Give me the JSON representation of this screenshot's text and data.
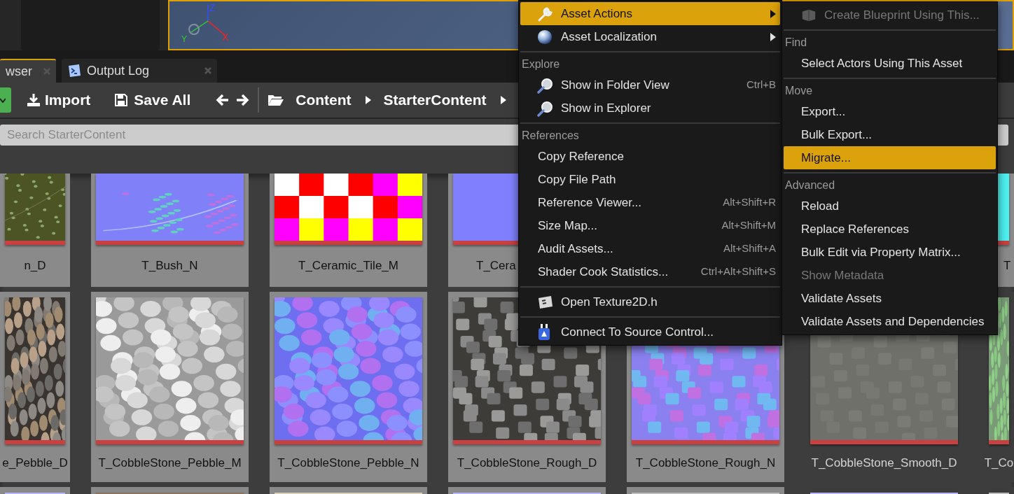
{
  "viewport": {
    "axis_labels": [
      "Z",
      "Y",
      "X"
    ]
  },
  "tabs": [
    {
      "label": "wser",
      "selected": true
    },
    {
      "label": "Output Log",
      "selected": false
    }
  ],
  "toolbar": {
    "buttons": [
      "Import",
      "Save All"
    ],
    "breadcrumbs": [
      "Content",
      "StarterContent"
    ]
  },
  "search": {
    "placeholder": "Search StarterContent"
  },
  "grid": {
    "rows": [
      {
        "tiles": [
          {
            "label": "n_D",
            "kind": "leaves",
            "selected": true,
            "clipped": false
          },
          {
            "label": "T_Bush_N",
            "kind": "normal-leaves",
            "selected": true,
            "clipped": false
          },
          {
            "label": "T_Ceramic_Tile_M",
            "kind": "checker",
            "selected": true,
            "clipped": false
          },
          {
            "label": "T_Cera",
            "kind": "flat-normal",
            "selected": true,
            "clipped": true
          },
          {
            "label": "T",
            "kind": "noise",
            "selected": true,
            "clipped": true
          }
        ]
      },
      {
        "tiles": [
          {
            "label": "e_Pebble_D",
            "kind": "pebble",
            "selected": true,
            "clipped": false
          },
          {
            "label": "T_CobbleStone_Pebble_M",
            "kind": "mask",
            "selected": true,
            "clipped": false
          },
          {
            "label": "T_CobbleStone_Pebble_N",
            "kind": "normal-pebble",
            "selected": true,
            "clipped": false
          },
          {
            "label": "T_CobbleStone_Rough_D",
            "kind": "cobble",
            "selected": true,
            "clipped": false
          },
          {
            "label": "T_CobbleStone_Rough_N",
            "kind": "normal-cobble",
            "selected": true,
            "clipped": false
          },
          {
            "label": "T_CobbleStone_Smooth_D",
            "kind": "smooth",
            "selected": false,
            "clipped": false
          },
          {
            "label": "T_Co",
            "kind": "moss",
            "selected": false,
            "clipped": false
          }
        ]
      },
      {
        "tiles": [
          {
            "kind": "lavender",
            "selected": true
          },
          {
            "kind": "sand",
            "selected": true
          },
          {
            "kind": "plaster",
            "selected": true
          },
          {
            "kind": "lavender",
            "selected": true
          },
          {
            "kind": "concrete",
            "selected": true
          },
          {
            "kind": "lavender",
            "selected": false
          },
          {
            "kind": "concrete",
            "selected": false
          }
        ]
      }
    ]
  },
  "context_menu": {
    "items": [
      {
        "kind": "item",
        "label": "Asset Actions",
        "selected": true,
        "submenu": true
      },
      {
        "kind": "item",
        "label": "Asset Localization",
        "selected": false,
        "submenu": true
      },
      {
        "kind": "separator"
      },
      {
        "kind": "header",
        "label": "Explore"
      },
      {
        "kind": "item",
        "label": "Show in Folder View",
        "shortcut": "Ctrl+B",
        "selected": false,
        "submenu": false
      },
      {
        "kind": "item",
        "label": "Show in Explorer",
        "selected": false,
        "submenu": false
      },
      {
        "kind": "separator"
      },
      {
        "kind": "header",
        "label": "References"
      },
      {
        "kind": "item",
        "label": "Copy Reference",
        "selected": false,
        "submenu": false
      },
      {
        "kind": "item",
        "label": "Copy File Path",
        "selected": false,
        "submenu": false
      },
      {
        "kind": "item",
        "label": "Reference Viewer...",
        "shortcut": "Alt+Shift+R",
        "selected": false,
        "submenu": false
      },
      {
        "kind": "item",
        "label": "Size Map...",
        "shortcut": "Alt+Shift+M",
        "selected": false,
        "submenu": false
      },
      {
        "kind": "item",
        "label": "Audit Assets...",
        "shortcut": "Alt+Shift+A",
        "selected": false,
        "submenu": false
      },
      {
        "kind": "item",
        "label": "Shader Cook Statistics...",
        "shortcut": "Ctrl+Alt+Shift+S",
        "selected": false,
        "submenu": false
      },
      {
        "kind": "separator"
      },
      {
        "kind": "item",
        "label": "Open Texture2D.h",
        "selected": false,
        "submenu": false
      },
      {
        "kind": "separator"
      },
      {
        "kind": "item",
        "label": "Connect To Source Control...",
        "selected": false,
        "submenu": false
      }
    ]
  },
  "submenu": {
    "items": [
      {
        "kind": "item",
        "label": "Create Blueprint Using This...",
        "selected": false,
        "disabled": true
      },
      {
        "kind": "separator"
      },
      {
        "kind": "header",
        "label": "Find"
      },
      {
        "kind": "item",
        "label": "Select Actors Using This Asset",
        "selected": false,
        "disabled": false
      },
      {
        "kind": "separator"
      },
      {
        "kind": "header",
        "label": "Move"
      },
      {
        "kind": "item",
        "label": "Export...",
        "selected": false,
        "disabled": false
      },
      {
        "kind": "item",
        "label": "Bulk Export...",
        "selected": false,
        "disabled": false
      },
      {
        "kind": "item",
        "label": "Migrate...",
        "selected": true,
        "disabled": false
      },
      {
        "kind": "separator"
      },
      {
        "kind": "header",
        "label": "Advanced"
      },
      {
        "kind": "item",
        "label": "Reload",
        "selected": false,
        "disabled": false
      },
      {
        "kind": "item",
        "label": "Replace References",
        "selected": false,
        "disabled": false
      },
      {
        "kind": "item",
        "label": "Bulk Edit via Property Matrix...",
        "selected": false,
        "disabled": false
      },
      {
        "kind": "item",
        "label": "Show Metadata",
        "selected": false,
        "disabled": true
      },
      {
        "kind": "item",
        "label": "Validate Assets",
        "selected": false,
        "disabled": false
      },
      {
        "kind": "item",
        "label": "Validate Assets and Dependencies",
        "selected": false,
        "disabled": false
      }
    ]
  }
}
